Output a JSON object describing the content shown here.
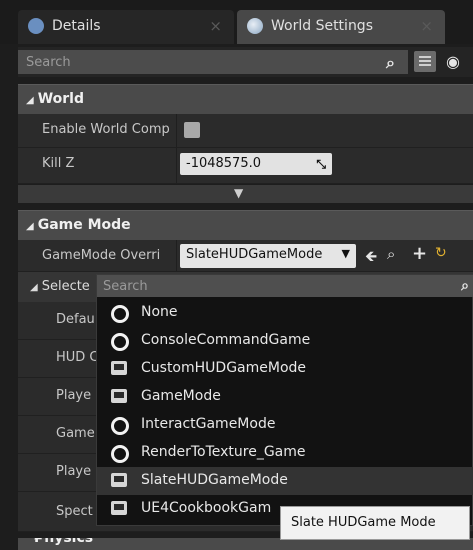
{
  "tabs": [
    {
      "label": "Details"
    },
    {
      "label": "World Settings"
    }
  ],
  "search": {
    "placeholder": "Search"
  },
  "world": {
    "header": "World",
    "enable_world_label": "Enable World Comp",
    "killz_label": "Kill Z",
    "killz_value": "-1048575.0"
  },
  "game_mode": {
    "header": "Game Mode",
    "override_label": "GameMode Overri",
    "override_value": "SlateHUDGameMode",
    "selected_header": "Selecte",
    "rows": [
      "Defau",
      "HUD C",
      "Playe",
      "Game",
      "Playe",
      "Spect"
    ]
  },
  "dropdown": {
    "search_placeholder": "Search",
    "options": [
      {
        "label": "None",
        "icon": "circle-icon"
      },
      {
        "label": "ConsoleCommandGame",
        "icon": "circle-icon"
      },
      {
        "label": "CustomHUDGameMode",
        "icon": "blueprint-icon"
      },
      {
        "label": "GameMode",
        "icon": "blueprint-icon"
      },
      {
        "label": "InteractGameMode",
        "icon": "circle-icon"
      },
      {
        "label": "RenderToTexture_Game",
        "icon": "circle-icon"
      },
      {
        "label": "SlateHUDGameMode",
        "icon": "blueprint-icon"
      },
      {
        "label": "UE4CookbookGam",
        "icon": "blueprint-icon"
      }
    ]
  },
  "tooltip": "Slate HUDGame Mode",
  "physics": {
    "header": "Physics"
  }
}
